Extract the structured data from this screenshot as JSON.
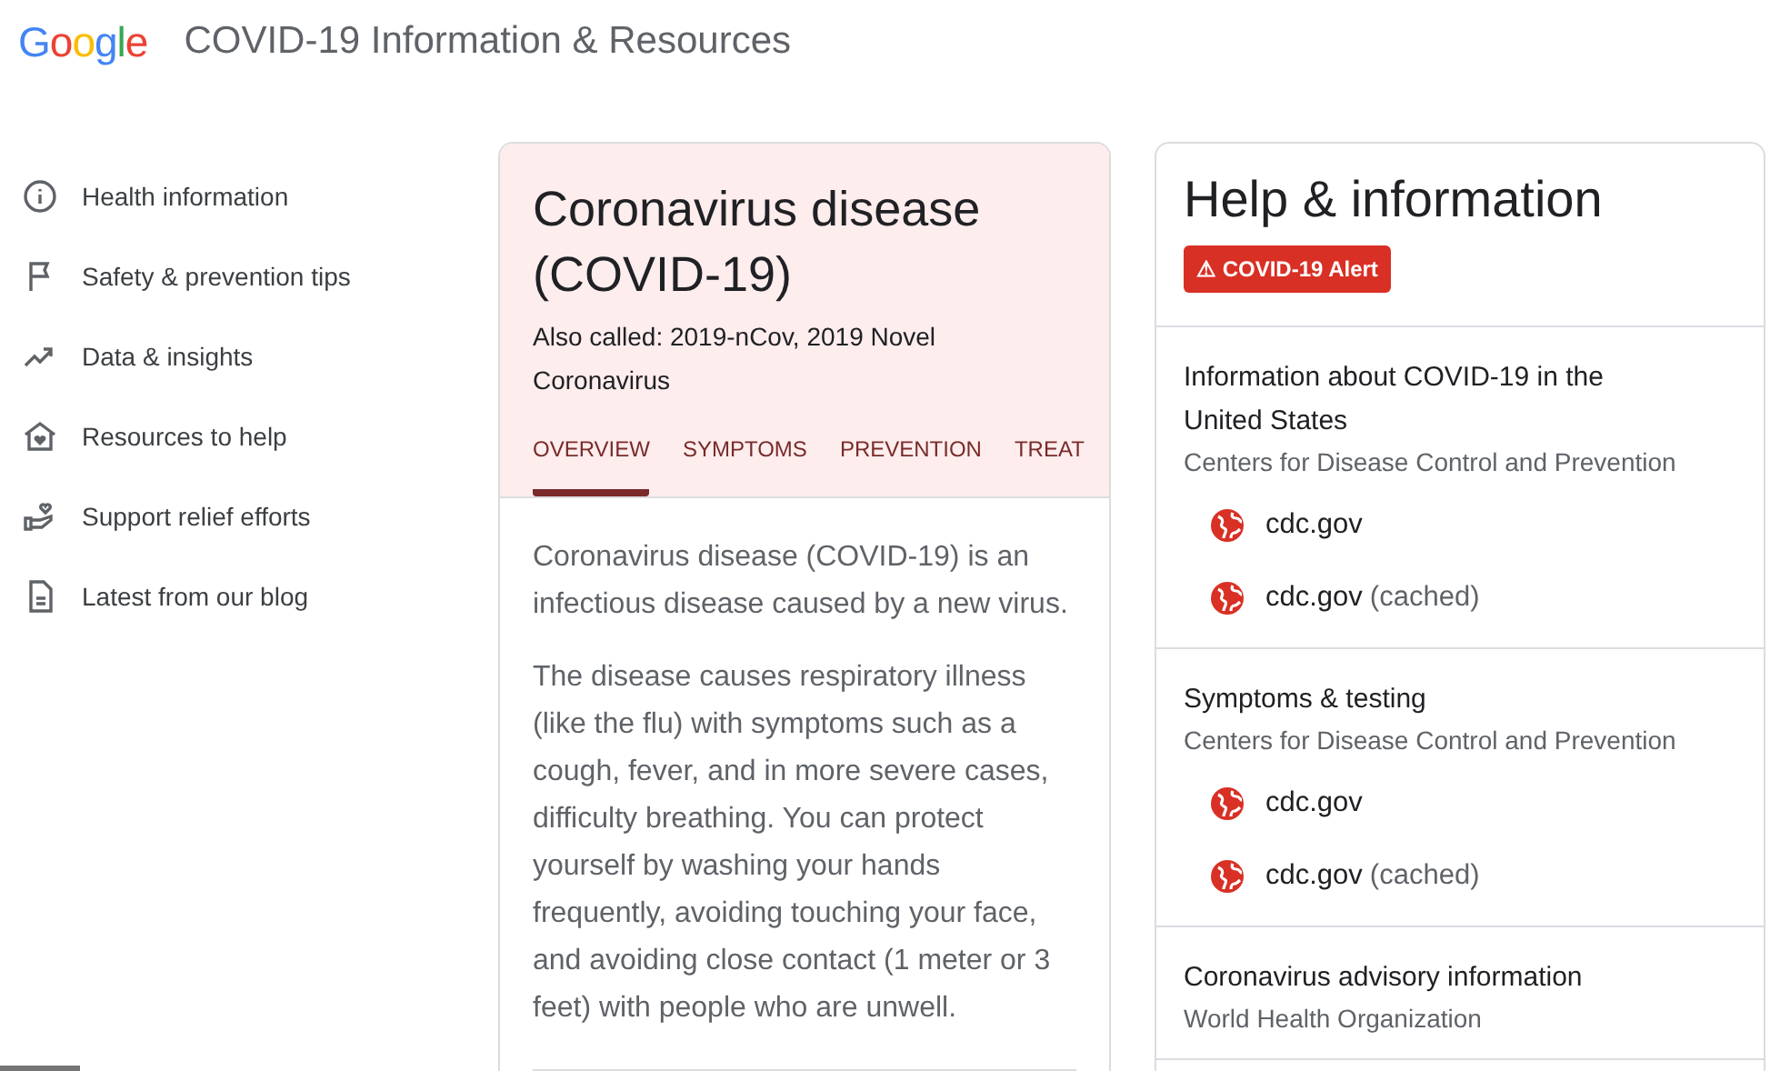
{
  "header": {
    "logo": "Google",
    "title": "COVID-19 Information & Resources"
  },
  "sidebar": {
    "items": [
      {
        "label": "Health information"
      },
      {
        "label": "Safety & prevention tips"
      },
      {
        "label": "Data & insights"
      },
      {
        "label": "Resources to help"
      },
      {
        "label": "Support relief efforts"
      },
      {
        "label": "Latest from our blog"
      }
    ]
  },
  "disease_card": {
    "title": "Coronavirus disease (COVID-19)",
    "subtitle": "Also called: 2019-nCov, 2019 Novel Coronavirus",
    "tabs": [
      {
        "label": "OVERVIEW",
        "selected": true
      },
      {
        "label": "SYMPTOMS",
        "selected": false
      },
      {
        "label": "PREVENTION",
        "selected": false
      },
      {
        "label": "TREAT",
        "selected": false
      }
    ],
    "paragraphs": [
      "Coronavirus disease (COVID-19) is an infectious disease caused by a new virus.",
      "The disease causes respiratory illness (like the flu) with symptoms such as a cough, fever, and in more severe cases, difficulty breathing. You can protect yourself by washing your hands frequently, avoiding touching your face, and avoiding close contact (1 meter or 3 feet) with people who are unwell."
    ]
  },
  "help_card": {
    "title": "Help & information",
    "alert": "⚠ COVID-19 Alert",
    "sections": [
      {
        "title": "Information about COVID-19 in the United States",
        "source": "Centers for Disease Control and Prevention",
        "links": [
          {
            "label": "cdc.gov"
          },
          {
            "label": "cdc.gov",
            "note": "(cached)"
          }
        ]
      },
      {
        "title": "Symptoms & testing",
        "source": "Centers for Disease Control and Prevention",
        "links": [
          {
            "label": "cdc.gov"
          },
          {
            "label": "cdc.gov",
            "note": "(cached)"
          }
        ]
      },
      {
        "title": "Coronavirus advisory information",
        "source": "World Health Organization"
      }
    ]
  }
}
